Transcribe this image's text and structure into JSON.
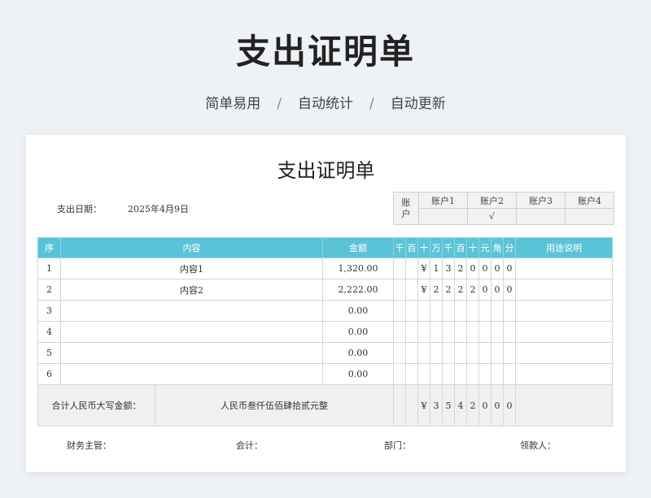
{
  "hero": {
    "title": "支出证明单",
    "tags": [
      "简单易用",
      "自动统计",
      "自动更新"
    ],
    "separator": "/"
  },
  "document": {
    "title": "支出证明单",
    "date_label": "支出日期：",
    "date_value": "2025年4月9日",
    "accounts": {
      "label_top": "账",
      "label_bottom": "户",
      "names": [
        "账户1",
        "账户2",
        "账户3",
        "账户4"
      ],
      "marks": [
        "",
        "√",
        "",
        ""
      ]
    },
    "table": {
      "headers": {
        "seq": "序",
        "content": "内容",
        "amount": "金额",
        "digits": [
          "千",
          "百",
          "十",
          "万",
          "千",
          "百",
          "十",
          "元",
          "角",
          "分"
        ],
        "purpose": "用途说明"
      },
      "rows": [
        {
          "seq": "1",
          "content": "内容1",
          "amount": "1,320.00",
          "digits": [
            "",
            "",
            "¥",
            "1",
            "3",
            "2",
            "0",
            "0",
            "0",
            "0"
          ],
          "purpose": ""
        },
        {
          "seq": "2",
          "content": "内容2",
          "amount": "2,222.00",
          "digits": [
            "",
            "",
            "¥",
            "2",
            "2",
            "2",
            "2",
            "0",
            "0",
            "0"
          ],
          "purpose": ""
        },
        {
          "seq": "3",
          "content": "",
          "amount": "0.00",
          "digits": [
            "",
            "",
            "",
            "",
            "",
            "",
            "",
            "",
            "",
            ""
          ],
          "purpose": ""
        },
        {
          "seq": "4",
          "content": "",
          "amount": "0.00",
          "digits": [
            "",
            "",
            "",
            "",
            "",
            "",
            "",
            "",
            "",
            ""
          ],
          "purpose": ""
        },
        {
          "seq": "5",
          "content": "",
          "amount": "0.00",
          "digits": [
            "",
            "",
            "",
            "",
            "",
            "",
            "",
            "",
            "",
            ""
          ],
          "purpose": ""
        },
        {
          "seq": "6",
          "content": "",
          "amount": "0.00",
          "digits": [
            "",
            "",
            "",
            "",
            "",
            "",
            "",
            "",
            "",
            ""
          ],
          "purpose": ""
        }
      ],
      "total": {
        "label": "合计人民币大写金额：",
        "uppercase": "人民币叁仟伍佰肆拾贰元整",
        "digits": [
          "",
          "",
          "¥",
          "3",
          "5",
          "4",
          "2",
          "0",
          "0",
          "0"
        ]
      }
    },
    "signatures": [
      "财务主管：",
      "会计：",
      "部门：",
      "领款人："
    ]
  }
}
